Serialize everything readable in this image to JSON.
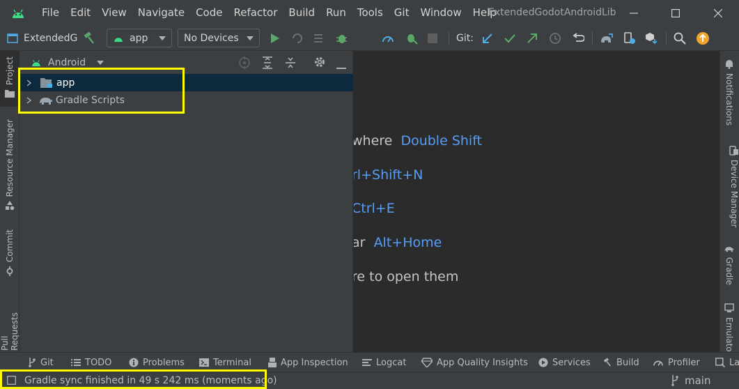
{
  "menu": [
    "File",
    "Edit",
    "View",
    "Navigate",
    "Code",
    "Refactor",
    "Build",
    "Run",
    "Tools",
    "Git",
    "Window",
    "Help"
  ],
  "window_title": "ExtendedGodotAndroidLib",
  "toolbar": {
    "project_name": "ExtendedG",
    "run_config": "app",
    "device": "No Devices",
    "git_label": "Git:"
  },
  "project_panel": {
    "view_mode": "Android",
    "tree": [
      {
        "label": "app",
        "icon": "folder-module-icon"
      },
      {
        "label": "Gradle Scripts",
        "icon": "gradle-elephant-icon"
      }
    ]
  },
  "left_tabs": [
    "Project",
    "Resource Manager",
    "Commit",
    "Pull Requests"
  ],
  "right_tabs": [
    "Notifications",
    "Device Manager",
    "Gradle",
    "Emulato"
  ],
  "editor_hints": [
    {
      "text": "where",
      "key": "Double Shift"
    },
    {
      "text": "",
      "key": "rl+Shift+N"
    },
    {
      "text": "",
      "key": "Ctrl+E"
    },
    {
      "text": "ar",
      "key": "Alt+Home"
    },
    {
      "text": "re to open them",
      "key": ""
    }
  ],
  "bottom_tabs": [
    "Git",
    "TODO",
    "Problems",
    "Terminal",
    "App Inspection",
    "Logcat",
    "App Quality Insights",
    "Services",
    "Build",
    "Profiler",
    "La"
  ],
  "status": {
    "message": "Gradle sync finished in 49 s 242 ms (moments ago)",
    "branch": "main"
  },
  "colors": {
    "accent_green": "#59a869",
    "link_blue": "#589df6",
    "highlight_yellow": "#ffff00",
    "selection": "#0d293e"
  }
}
